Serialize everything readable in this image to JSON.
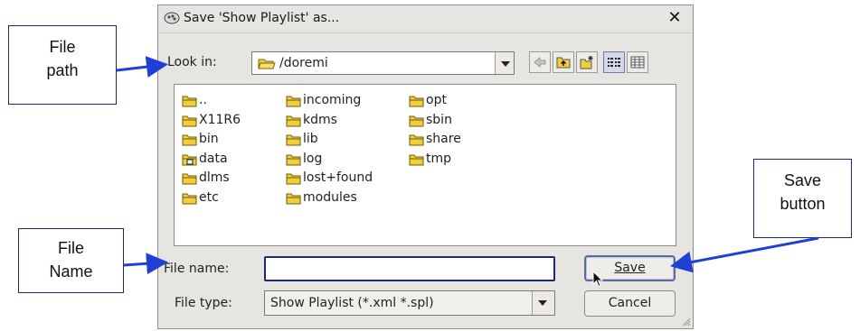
{
  "dialog": {
    "title": "Save 'Show Playlist' as...",
    "close_glyph": "✕",
    "look_in_label": "Look in:",
    "look_in_value": "/doremi",
    "file_name_label": "File name:",
    "file_name_value": "",
    "file_type_label": "File type:",
    "file_type_value": "Show Playlist (*.xml *.spl)",
    "save_label": "Save",
    "cancel_label": "Cancel",
    "files": [
      {
        "name": "..",
        "icon": "folder-icon"
      },
      {
        "name": "X11R6",
        "icon": "folder-icon"
      },
      {
        "name": "bin",
        "icon": "folder-icon"
      },
      {
        "name": "data",
        "icon": "folder-link-icon"
      },
      {
        "name": "dlms",
        "icon": "folder-icon"
      },
      {
        "name": "etc",
        "icon": "folder-icon"
      },
      {
        "name": "incoming",
        "icon": "folder-icon"
      },
      {
        "name": "kdms",
        "icon": "folder-icon"
      },
      {
        "name": "lib",
        "icon": "folder-icon"
      },
      {
        "name": "log",
        "icon": "folder-icon"
      },
      {
        "name": "lost+found",
        "icon": "folder-icon"
      },
      {
        "name": "modules",
        "icon": "folder-icon"
      },
      {
        "name": "opt",
        "icon": "folder-icon"
      },
      {
        "name": "sbin",
        "icon": "folder-icon"
      },
      {
        "name": "share",
        "icon": "folder-icon"
      },
      {
        "name": "tmp",
        "icon": "folder-icon"
      }
    ],
    "toolbar_icons": [
      "back-icon",
      "parent-folder-icon",
      "new-folder-icon",
      "list-view-icon",
      "detail-view-icon"
    ]
  },
  "callouts": {
    "file_path": [
      "File",
      "path"
    ],
    "file_name": [
      "File",
      "Name"
    ],
    "save_button": [
      "Save",
      "button"
    ]
  },
  "colors": {
    "dialog_bg": "#e7e5e2",
    "callout_border": "#1a2a6c",
    "arrow": "#1f3fd6",
    "input_border": "#1c2c72",
    "folder_fill": "#f1cf3a"
  }
}
